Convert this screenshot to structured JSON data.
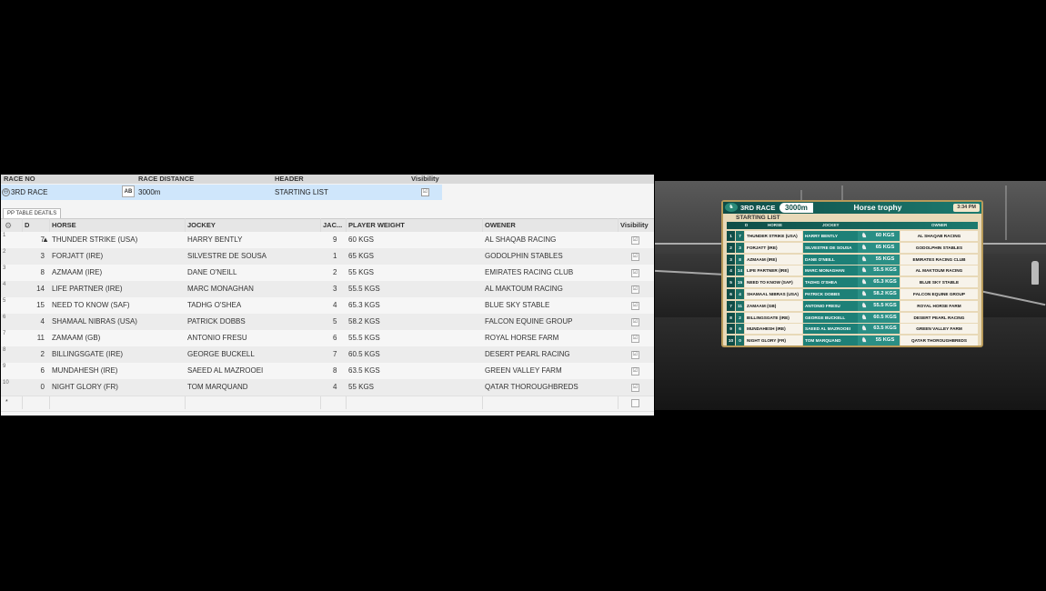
{
  "editor": {
    "header": {
      "race_no": "RACE NO",
      "race_distance": "RACE DISTANCE",
      "header": "HEADER",
      "visibility": "Visibility"
    },
    "race": {
      "expander": "⊖",
      "race_no": "3RD RACE",
      "ab_button": "AB",
      "distance": "3000m",
      "header": "STARTING LIST",
      "visible": "☑"
    },
    "tab_label": "PP TABLE DEATILS",
    "grid_columns": {
      "d": "D",
      "horse": "HORSE",
      "jockey": "JOCKEY",
      "jac": "JAC...",
      "weight": "PLAYER WEIGHT",
      "owner": "OWENER",
      "visibility": "Visibility"
    },
    "rows": [
      {
        "num": "1",
        "d": "7",
        "horse": "THUNDER STRIKE (USA)",
        "jockey": "HARRY BENTLY",
        "jac": "9",
        "weight": "60 KGS",
        "owner": "AL SHAQAB RACING",
        "check": "☑"
      },
      {
        "num": "2",
        "d": "3",
        "horse": "FORJATT (IRE)",
        "jockey": "SILVESTRE DE SOUSA",
        "jac": "1",
        "weight": "65 KGS",
        "owner": "GODOLPHIN STABLES",
        "check": "☑"
      },
      {
        "num": "3",
        "d": "8",
        "horse": "AZMAAM (IRE)",
        "jockey": "DANE O'NEILL",
        "jac": "2",
        "weight": " 55 KGS",
        "owner": "EMIRATES RACING CLUB",
        "check": "☑"
      },
      {
        "num": "4",
        "d": "14",
        "horse": "LIFE PARTNER (IRE)",
        "jockey": "MARC MONAGHAN",
        "jac": "3",
        "weight": "55.5 KGS",
        "owner": "AL MAKTOUM RACING",
        "check": "☑"
      },
      {
        "num": "5",
        "d": "15",
        "horse": "NEED TO KNOW (SAF)",
        "jockey": "TADHG O'SHEA",
        "jac": "4",
        "weight": "65.3 KGS",
        "owner": "BLUE SKY STABLE",
        "check": "☑"
      },
      {
        "num": "6",
        "d": "4",
        "horse": "SHAMAAL NIBRAS (USA)",
        "jockey": "PATRICK DOBBS",
        "jac": "5",
        "weight": "58.2 KGS",
        "owner": "FALCON EQUINE GROUP",
        "check": "☑"
      },
      {
        "num": "7",
        "d": "11",
        "horse": "ZAMAAM (GB)",
        "jockey": "ANTONIO FRESU",
        "jac": "6",
        "weight": "55.5 KGS",
        "owner": "ROYAL HORSE FARM",
        "check": "☑"
      },
      {
        "num": "8",
        "d": "2",
        "horse": "BILLINGSGATE (IRE)",
        "jockey": "GEORGE BUCKELL",
        "jac": "7",
        "weight": "60.5 KGS",
        "owner": "DESERT PEARL RACING",
        "check": "☑"
      },
      {
        "num": "9",
        "d": "6",
        "horse": "MUNDAHESH (IRE)",
        "jockey": "SAEED AL MAZROOEI",
        "jac": "8",
        "weight": "63.5 KGS",
        "owner": "GREEN VALLEY FARM",
        "check": "☑"
      },
      {
        "num": "10",
        "d": "0",
        "horse": "NIGHT GLORY (FR)",
        "jockey": "TOM MARQUAND",
        "jac": "4",
        "weight": "55 KGS",
        "owner": "QATAR THOROUGHBREDS",
        "check": "☑"
      }
    ],
    "new_row_marker": "*"
  },
  "preview": {
    "race_label": "3RD RACE",
    "distance": "3000m",
    "title": "Horse trophy",
    "time": "3:34 PM",
    "subtitle": "STARTING LIST",
    "columns": {
      "d": "D",
      "horse": "HORSE",
      "jockey": "JOCKEY",
      "owner": "OWNER"
    },
    "rows": [
      {
        "no": "1",
        "d": "7",
        "horse": "THUNDER STRIKE (USA)",
        "jockey": "HARRY BENTLY",
        "weight": "60 KGS",
        "owner": "AL SHAQAB RACING"
      },
      {
        "no": "2",
        "d": "3",
        "horse": "FORJATT (IRE)",
        "jockey": "SILVESTRE DE SOUSA",
        "weight": "65 KGS",
        "owner": "GODOLPHIN STABLES"
      },
      {
        "no": "3",
        "d": "8",
        "horse": "AZMAAM (IRE)",
        "jockey": "DANE O'NEILL",
        "weight": "55 KGS",
        "owner": "EMIRATES RACING CLUB"
      },
      {
        "no": "4",
        "d": "14",
        "horse": "LIFE PARTNER (IRE)",
        "jockey": "MARC MONAGHAN",
        "weight": "55.5 KGS",
        "owner": "AL MAKTOUM RACING"
      },
      {
        "no": "5",
        "d": "15",
        "horse": "NEED TO KNOW (SAF)",
        "jockey": "TADHG O'SHEA",
        "weight": "65.3 KGS",
        "owner": "BLUE SKY STABLE"
      },
      {
        "no": "6",
        "d": "4",
        "horse": "SHAMAAL NIBRAS (USA)",
        "jockey": "PATRICK DOBBS",
        "weight": "58.2 KGS",
        "owner": "FALCON EQUINE GROUP"
      },
      {
        "no": "7",
        "d": "11",
        "horse": "ZAMAAM (GB)",
        "jockey": "ANTONIO FRESU",
        "weight": "55.5 KGS",
        "owner": "ROYAL HORSE FARM"
      },
      {
        "no": "8",
        "d": "2",
        "horse": "BILLINGSGATE (IRE)",
        "jockey": "GEORGE BUCKELL",
        "weight": "60.5 KGS",
        "owner": "DESERT PEARL RACING"
      },
      {
        "no": "9",
        "d": "6",
        "horse": "MUNDAHESH (IRE)",
        "jockey": "SAEED AL MAZROOEI",
        "weight": "63.5 KGS",
        "owner": "GREEN VALLEY FARM"
      },
      {
        "no": "10",
        "d": "0",
        "horse": "NIGHT GLORY (FR)",
        "jockey": "TOM MARQUAND",
        "weight": "55 KGS",
        "owner": "QATAR THOROUGHBREDS"
      }
    ]
  },
  "colors": {
    "accent_teal": "#1c7a6f",
    "selected_row": "#cfe6fb",
    "frame_gold": "#b89a5a"
  },
  "icons": {
    "settings": "gear-icon",
    "silks": "jockey-silk-icon",
    "logo": "race-logo-icon"
  }
}
